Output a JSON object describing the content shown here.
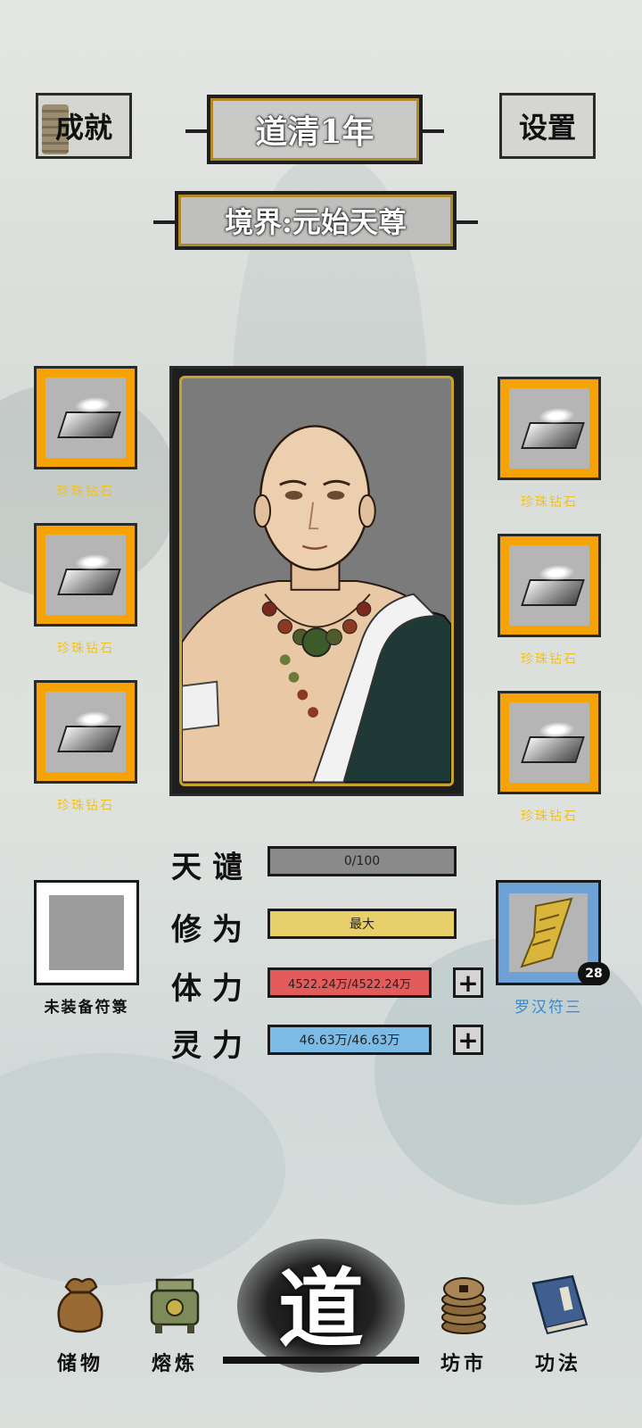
{
  "header": {
    "achievements_label": "成就",
    "settings_label": "设置",
    "year_title": "道清1年",
    "realm_title": "境界:元始天尊"
  },
  "equipment": {
    "left": [
      {
        "label": "珍珠钻石"
      },
      {
        "label": "珍珠钻石"
      },
      {
        "label": "珍珠钻石"
      }
    ],
    "right": [
      {
        "label": "珍珠钻石"
      },
      {
        "label": "珍珠钻石"
      },
      {
        "label": "珍珠钻石"
      }
    ]
  },
  "talisman": {
    "empty_label": "未装备符箓",
    "equipped_label": "罗汉符三",
    "equipped_count": "28"
  },
  "stats": [
    {
      "name": "天谴",
      "value": "0/100",
      "fill": 0.0,
      "color": "#8a8a8a"
    },
    {
      "name": "修为",
      "value": "最大",
      "fill": 1.0,
      "color": "#e7cf6a"
    },
    {
      "name": "体力",
      "value": "4522.24万/4522.24万",
      "fill": 1.0,
      "color": "#e45b5b"
    },
    {
      "name": "灵力",
      "value": "46.63万/46.63万",
      "fill": 1.0,
      "color": "#7bbbe6"
    }
  ],
  "nav": {
    "storage": "储物",
    "refine": "熔炼",
    "dao": "道",
    "market": "坊市",
    "skills": "功法"
  },
  "colors": {
    "slot_gold": "#f6a307",
    "slot_label": "#f1c21b",
    "talisman_blue": "#6ea2d6"
  }
}
